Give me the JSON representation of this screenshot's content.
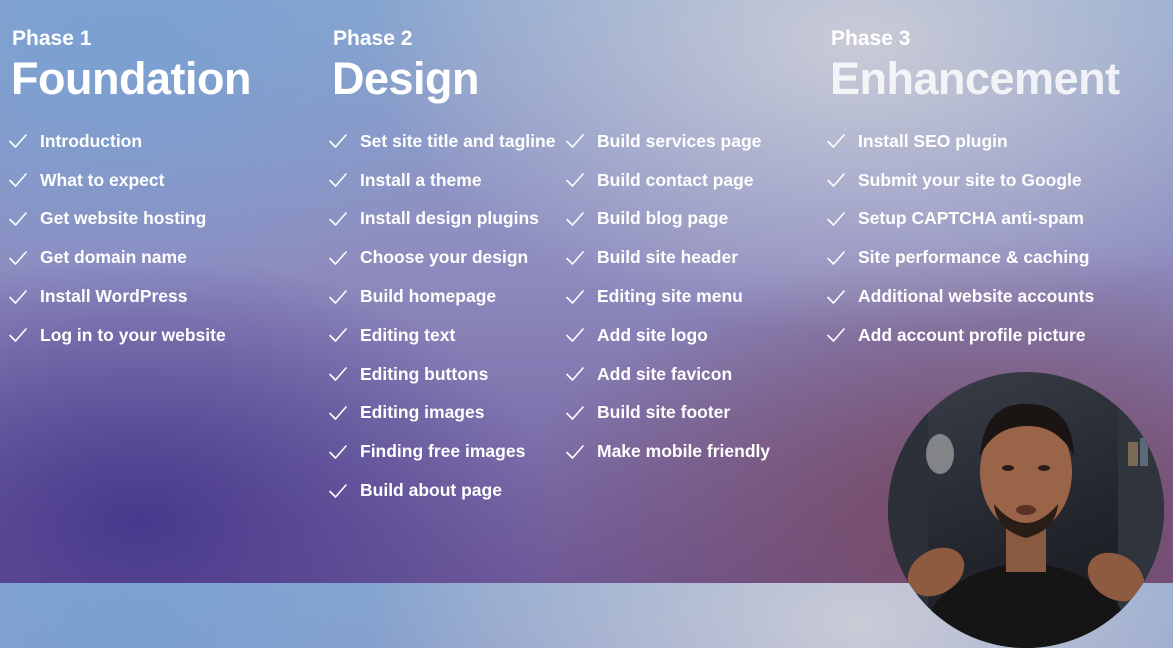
{
  "phases": [
    {
      "label": "Phase 1",
      "title": "Foundation",
      "items": [
        "Introduction",
        "What to expect",
        "Get website hosting",
        "Get domain name",
        "Install WordPress",
        "Log in to your website"
      ]
    },
    {
      "label": "Phase 2",
      "title": "Design",
      "items_left": [
        "Set site title and tagline",
        "Install a theme",
        "Install design plugins",
        "Choose your design",
        "Build homepage",
        "Editing text",
        "Editing buttons",
        "Editing images",
        "Finding free images",
        "Build about page"
      ],
      "items_right": [
        "Build services page",
        "Build contact page",
        "Build blog page",
        "Build site header",
        "Editing site menu",
        "Add site logo",
        "Add site favicon",
        "Build site footer",
        "Make mobile friendly"
      ]
    },
    {
      "label": "Phase 3",
      "title": "Enhancement",
      "items": [
        "Install SEO plugin",
        "Submit your site to Google",
        "Setup CAPTCHA anti-spam",
        "Site performance & caching",
        "Additional website accounts",
        "Add account profile picture"
      ]
    }
  ],
  "icons": {
    "item_marker": "checkmark-icon"
  }
}
